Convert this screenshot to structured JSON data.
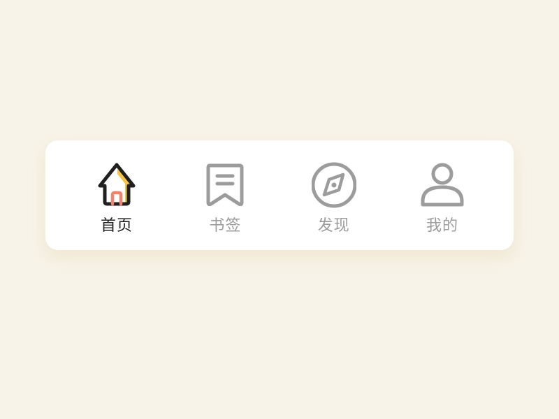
{
  "tabbar": {
    "tabs": [
      {
        "id": "home",
        "label": "首页",
        "icon": "home-icon",
        "active": true
      },
      {
        "id": "bookmarks",
        "label": "书签",
        "icon": "bookmark-icon",
        "active": false
      },
      {
        "id": "discover",
        "label": "发现",
        "icon": "compass-icon",
        "active": false
      },
      {
        "id": "profile",
        "label": "我的",
        "icon": "user-icon",
        "active": false
      }
    ]
  },
  "colors": {
    "background": "#F7F3E8",
    "surface": "#FFFFFF",
    "active_text": "#1F1F1F",
    "inactive": "#9C9C9C",
    "accent_yellow": "#F6C344",
    "accent_coral": "#F2836B"
  }
}
